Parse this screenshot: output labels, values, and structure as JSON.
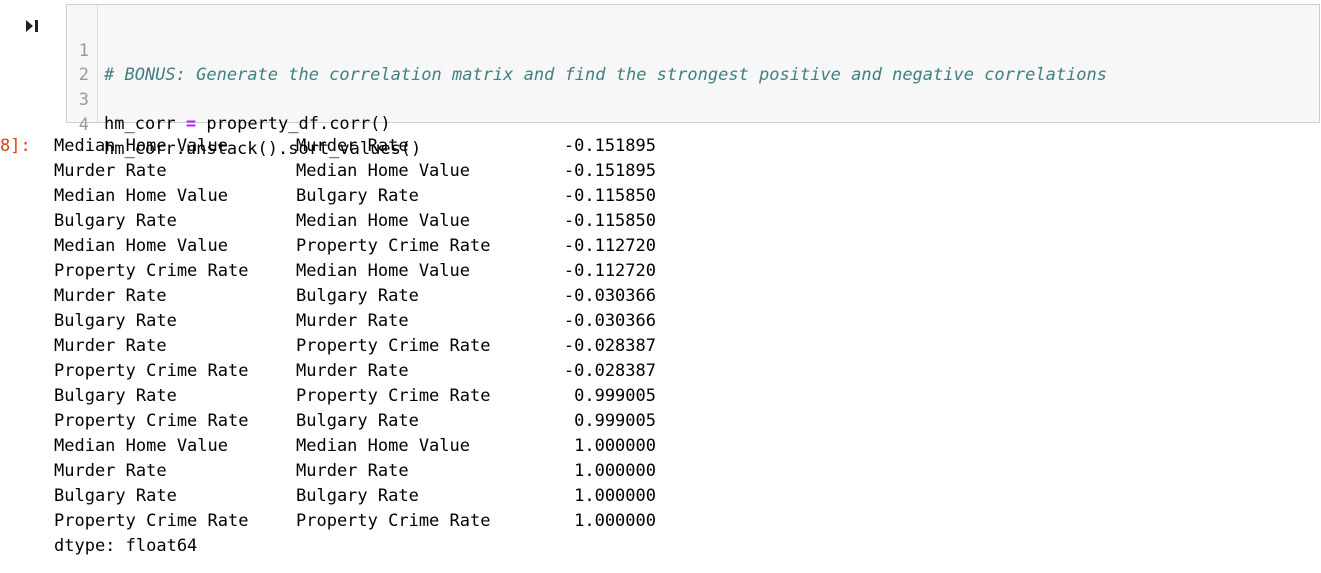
{
  "cell": {
    "run_glyph": "▶|",
    "prompt": "8]:",
    "code_lines": [
      {
        "num": "1",
        "comment": "# BONUS: Generate the correlation matrix and find the strongest positive and negative correlations"
      },
      {
        "num": "2"
      },
      {
        "num": "3",
        "lhs": "hm_corr ",
        "op": "=",
        "rhs": " property_df.corr()"
      },
      {
        "num": "4",
        "code": "hm_corr.unstack().sort_values()"
      }
    ]
  },
  "output": {
    "rows": [
      {
        "a": "Median Home Value",
        "b": "Murder Rate",
        "v": "-0.151895"
      },
      {
        "a": "Murder Rate",
        "b": "Median Home Value",
        "v": "-0.151895"
      },
      {
        "a": "Median Home Value",
        "b": "Bulgary Rate",
        "v": "-0.115850"
      },
      {
        "a": "Bulgary Rate",
        "b": "Median Home Value",
        "v": "-0.115850"
      },
      {
        "a": "Median Home Value",
        "b": "Property Crime Rate",
        "v": "-0.112720"
      },
      {
        "a": "Property Crime Rate",
        "b": "Median Home Value",
        "v": "-0.112720"
      },
      {
        "a": "Murder Rate",
        "b": "Bulgary Rate",
        "v": "-0.030366"
      },
      {
        "a": "Bulgary Rate",
        "b": "Murder Rate",
        "v": "-0.030366"
      },
      {
        "a": "Murder Rate",
        "b": "Property Crime Rate",
        "v": "-0.028387"
      },
      {
        "a": "Property Crime Rate",
        "b": "Murder Rate",
        "v": "-0.028387"
      },
      {
        "a": "Bulgary Rate",
        "b": "Property Crime Rate",
        "v": "0.999005"
      },
      {
        "a": "Property Crime Rate",
        "b": "Bulgary Rate",
        "v": "0.999005"
      },
      {
        "a": "Median Home Value",
        "b": "Median Home Value",
        "v": "1.000000"
      },
      {
        "a": "Murder Rate",
        "b": "Murder Rate",
        "v": "1.000000"
      },
      {
        "a": "Bulgary Rate",
        "b": "Bulgary Rate",
        "v": "1.000000"
      },
      {
        "a": "Property Crime Rate",
        "b": "Property Crime Rate",
        "v": "1.000000"
      }
    ],
    "dtype": "dtype: float64"
  },
  "colors": {
    "comment": "#408080",
    "operator": "#aa22ff",
    "prompt": "#d84315",
    "line_number": "#999999"
  }
}
